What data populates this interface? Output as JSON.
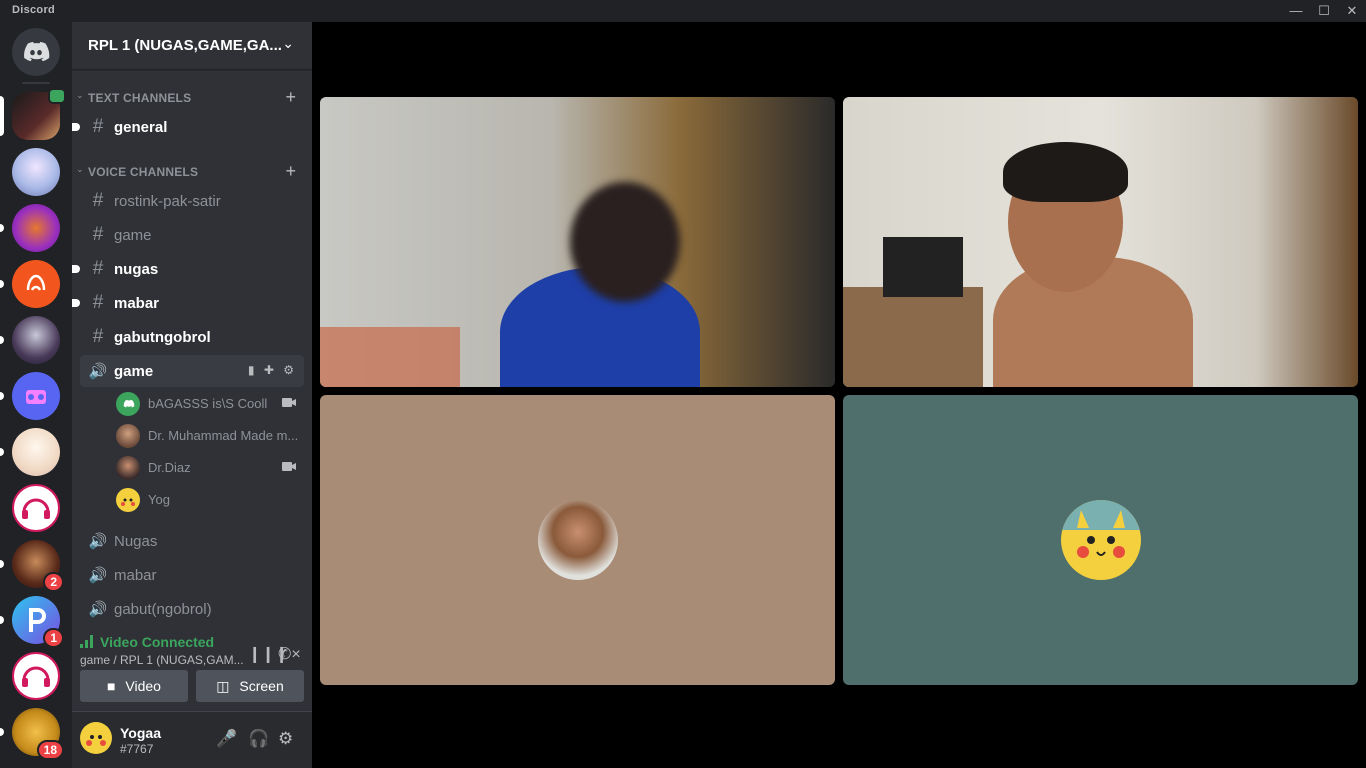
{
  "window": {
    "app_title": "Discord"
  },
  "servers": {
    "home_label": "Home",
    "items": [
      {
        "name": "server-1",
        "badge": ""
      },
      {
        "name": "server-2",
        "badge": ""
      },
      {
        "name": "server-3",
        "badge": ""
      },
      {
        "name": "server-4",
        "badge": ""
      },
      {
        "name": "server-5",
        "badge": ""
      },
      {
        "name": "server-6",
        "badge": ""
      },
      {
        "name": "server-7",
        "badge": ""
      },
      {
        "name": "server-8",
        "badge": ""
      },
      {
        "name": "server-9",
        "badge": "2"
      },
      {
        "name": "server-10",
        "badge": "1"
      },
      {
        "name": "server-11",
        "badge": ""
      },
      {
        "name": "server-12",
        "badge": "18"
      }
    ]
  },
  "guild": {
    "name": "RPL 1 (NUGAS,GAME,GA..."
  },
  "categories": {
    "text": "TEXT CHANNELS",
    "voice": "VOICE CHANNELS"
  },
  "channels": [
    {
      "name": "general",
      "icon": "hash-icon"
    },
    {
      "name": "rostink-pak-satir",
      "icon": "hash-icon"
    },
    {
      "name": "game",
      "icon": "hash-icon"
    },
    {
      "name": "nugas",
      "icon": "hash-icon"
    },
    {
      "name": "mabar",
      "icon": "hash-icon"
    },
    {
      "name": "gabutngobrol",
      "icon": "hash-icon"
    },
    {
      "name": "game",
      "icon": "speaker-icon"
    },
    {
      "name": "Nugas",
      "icon": "speaker-icon"
    },
    {
      "name": "mabar",
      "icon": "speaker-icon"
    },
    {
      "name": "gabut(ngobrol)",
      "icon": "speaker-icon"
    }
  ],
  "voice_users": [
    {
      "name": "bAGASSS is\\S Cooll",
      "camera": true
    },
    {
      "name": "Dr. Muhammad Made m...",
      "camera": false
    },
    {
      "name": "Dr.Diaz",
      "camera": true
    },
    {
      "name": "Yog",
      "camera": false
    }
  ],
  "voice_panel": {
    "status": "Video Connected",
    "location": "game / RPL 1 (NUGAS,GAM...",
    "video_label": "Video",
    "screen_label": "Screen"
  },
  "user": {
    "name": "Yogaa",
    "tag": "#7767"
  },
  "colors": {
    "accent": "#5865f2",
    "connected": "#3ba55d",
    "tile_tan": "#a88c76",
    "tile_teal": "#4e6f6b"
  }
}
